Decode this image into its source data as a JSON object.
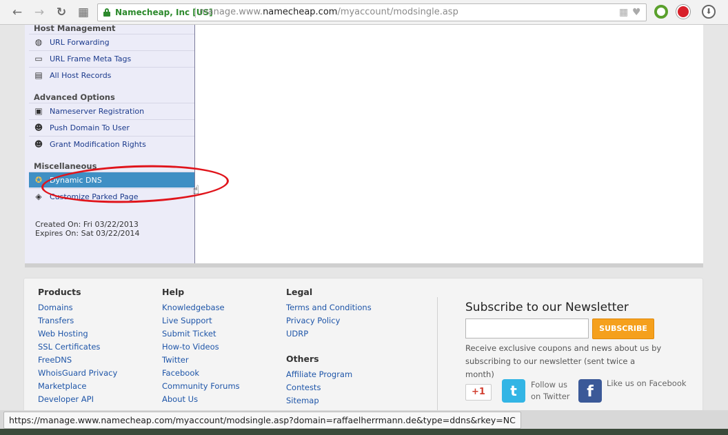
{
  "browser": {
    "ev_label": "Namecheap, Inc [US]",
    "url_prefix": "manage.www.",
    "url_domain": "namecheap.com",
    "url_path": "/myaccount/modsingle.asp",
    "back_icon": "←",
    "forward_icon": "→",
    "reload_icon": "↻",
    "apps_icon": "▦"
  },
  "sidebar": {
    "host_management": {
      "heading": "Host Management",
      "items": [
        {
          "label": "URL Forwarding",
          "icon": "globe-icon"
        },
        {
          "label": "URL Frame Meta Tags",
          "icon": "window-icon"
        },
        {
          "label": "All Host Records",
          "icon": "records-icon"
        }
      ]
    },
    "advanced_options": {
      "heading": "Advanced Options",
      "items": [
        {
          "label": "Nameserver Registration",
          "icon": "server-icon"
        },
        {
          "label": "Push Domain To User",
          "icon": "user-icon"
        },
        {
          "label": "Grant Modification Rights",
          "icon": "user-icon"
        }
      ]
    },
    "miscellaneous": {
      "heading": "Miscellaneous",
      "items": [
        {
          "label": "Dynamic DNS",
          "icon": "dns-icon",
          "active": true
        },
        {
          "label": "Customize Parked Page",
          "icon": "page-icon"
        }
      ]
    },
    "created_on": "Created On: Fri 03/22/2013",
    "expires_on": "Expires On: Sat 03/22/2014"
  },
  "footer": {
    "products": {
      "heading": "Products",
      "links": [
        "Domains",
        "Transfers",
        "Web Hosting",
        "SSL Certificates",
        "FreeDNS",
        "WhoisGuard Privacy",
        "Marketplace",
        "Developer API"
      ]
    },
    "help": {
      "heading": "Help",
      "links": [
        "Knowledgebase",
        "Live Support",
        "Submit Ticket",
        "How-to Videos",
        "Twitter",
        "Facebook",
        "Community Forums",
        "About Us"
      ]
    },
    "legal": {
      "heading": "Legal",
      "links": [
        "Terms and Conditions",
        "Privacy Policy",
        "UDRP"
      ]
    },
    "others": {
      "heading": "Others",
      "links": [
        "Affiliate Program",
        "Contests",
        "Sitemap"
      ]
    },
    "newsletter": {
      "title": "Subscribe to our Newsletter",
      "button": "SUBSCRIBE",
      "description": "Receive exclusive coupons and news about us by subscribing to our newsletter (sent twice a month)"
    },
    "social": {
      "gplus": "+1",
      "twitter_line1": "Follow us",
      "twitter_line2": "on Twitter",
      "facebook": "Like us on Facebook"
    }
  },
  "status_bar": {
    "url": "https://manage.www.namecheap.com/myaccount/modsingle.asp?domain=raffaelherrmann.de&type=ddns&rkey=NC"
  }
}
